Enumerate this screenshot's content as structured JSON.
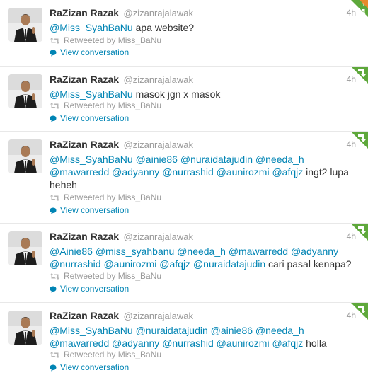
{
  "tweets": [
    {
      "name": "RaZizan Razak",
      "username": "@zizanrajalawak",
      "time": "4h",
      "lines": [
        [
          {
            "t": "@Miss_SyahBaNu",
            "m": true
          },
          {
            "t": " apa website?",
            "m": false
          }
        ]
      ],
      "retweeted_by": "Retweeted by Miss_BaNu",
      "view_conversation": "View conversation",
      "badge": "reply-retweet-corner-icon"
    },
    {
      "name": "RaZizan Razak",
      "username": "@zizanrajalawak",
      "time": "4h",
      "lines": [
        [
          {
            "t": "@Miss_SyahBaNu",
            "m": true
          },
          {
            "t": " masok jgn x masok",
            "m": false
          }
        ]
      ],
      "retweeted_by": "Retweeted by Miss_BaNu",
      "view_conversation": "View conversation",
      "badge": "retweet-corner-icon"
    },
    {
      "name": "RaZizan Razak",
      "username": "@zizanrajalawak",
      "time": "4h",
      "lines": [
        [
          {
            "t": "@Miss_SyahBaNu",
            "m": true
          },
          {
            "t": " ",
            "m": false
          },
          {
            "t": "@ainie86",
            "m": true
          },
          {
            "t": " ",
            "m": false
          },
          {
            "t": "@nuraidatajudin",
            "m": true
          },
          {
            "t": " ",
            "m": false
          },
          {
            "t": "@needa_h",
            "m": true
          }
        ],
        [
          {
            "t": "@mawarredd",
            "m": true
          },
          {
            "t": " ",
            "m": false
          },
          {
            "t": "@adyanny",
            "m": true
          },
          {
            "t": " ",
            "m": false
          },
          {
            "t": "@nurrashid",
            "m": true
          },
          {
            "t": " ",
            "m": false
          },
          {
            "t": "@aunirozmi",
            "m": true
          },
          {
            "t": " ",
            "m": false
          },
          {
            "t": "@afqjz",
            "m": true
          },
          {
            "t": " ingt2 lupa",
            "m": false
          }
        ],
        [
          {
            "t": "heheh",
            "m": false
          }
        ]
      ],
      "retweeted_by": "Retweeted by Miss_BaNu",
      "view_conversation": "View conversation",
      "badge": "retweet-corner-icon"
    },
    {
      "name": "RaZizan Razak",
      "username": "@zizanrajalawak",
      "time": "4h",
      "lines": [
        [
          {
            "t": "@Ainie86",
            "m": true
          },
          {
            "t": " ",
            "m": false
          },
          {
            "t": "@miss_syahbanu",
            "m": true
          },
          {
            "t": " ",
            "m": false
          },
          {
            "t": "@needa_h",
            "m": true
          },
          {
            "t": " ",
            "m": false
          },
          {
            "t": "@mawarredd",
            "m": true
          },
          {
            "t": " ",
            "m": false
          },
          {
            "t": "@adyanny",
            "m": true
          }
        ],
        [
          {
            "t": "@nurrashid",
            "m": true
          },
          {
            "t": " ",
            "m": false
          },
          {
            "t": "@aunirozmi",
            "m": true
          },
          {
            "t": " ",
            "m": false
          },
          {
            "t": "@afqjz",
            "m": true
          },
          {
            "t": " ",
            "m": false
          },
          {
            "t": "@nuraidatajudin",
            "m": true
          },
          {
            "t": " cari pasal kenapa?",
            "m": false
          }
        ]
      ],
      "retweeted_by": "Retweeted by Miss_BaNu",
      "view_conversation": "View conversation",
      "badge": "retweet-corner-icon"
    },
    {
      "name": "RaZizan Razak",
      "username": "@zizanrajalawak",
      "time": "4h",
      "lines": [
        [
          {
            "t": "@Miss_SyahBaNu",
            "m": true
          },
          {
            "t": " ",
            "m": false
          },
          {
            "t": "@nuraidatajudin",
            "m": true
          },
          {
            "t": " ",
            "m": false
          },
          {
            "t": "@ainie86",
            "m": true
          },
          {
            "t": " ",
            "m": false
          },
          {
            "t": "@needa_h",
            "m": true
          }
        ],
        [
          {
            "t": "@mawarredd",
            "m": true
          },
          {
            "t": " ",
            "m": false
          },
          {
            "t": "@adyanny",
            "m": true
          },
          {
            "t": " ",
            "m": false
          },
          {
            "t": "@nurrashid",
            "m": true
          },
          {
            "t": " ",
            "m": false
          },
          {
            "t": "@aunirozmi",
            "m": true
          },
          {
            "t": " ",
            "m": false
          },
          {
            "t": "@afqjz",
            "m": true
          },
          {
            "t": " holla",
            "m": false
          }
        ]
      ],
      "retweeted_by": "Retweeted by Miss_BaNu",
      "view_conversation": "View conversation",
      "badge": "retweet-corner-icon"
    }
  ],
  "colors": {
    "link": "#0084b4",
    "muted": "#999999",
    "text": "#333333",
    "retweet_green": "#5ea83b",
    "reply_orange": "#e8892b"
  }
}
